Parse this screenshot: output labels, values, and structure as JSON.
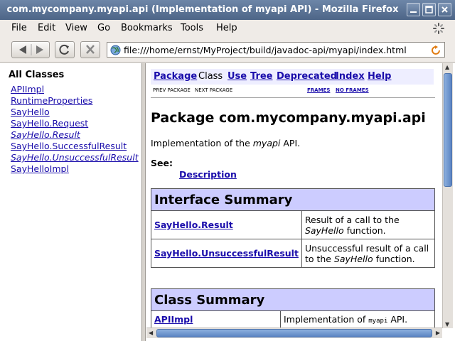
{
  "window": {
    "title": "com.mycompany.myapi.api (Implementation of myapi API) - Mozilla Firefox"
  },
  "menu": [
    "File",
    "Edit",
    "View",
    "Go",
    "Bookmarks",
    "Tools",
    "Help"
  ],
  "toolbar": {
    "back_icon": "back-arrow-icon",
    "forward_icon": "forward-arrow-icon",
    "reload_icon": "reload-icon",
    "stop_icon": "stop-icon",
    "url": "file:///home/ernst/MyProject/build/javadoc-api/myapi/index.html"
  },
  "left_frame": {
    "heading": "All Classes",
    "classes": [
      {
        "name": "APIImpl",
        "italic": false
      },
      {
        "name": "RuntimeProperties",
        "italic": false
      },
      {
        "name": "SayHello",
        "italic": false
      },
      {
        "name": "SayHello.Request",
        "italic": false
      },
      {
        "name": "SayHello.Result",
        "italic": true
      },
      {
        "name": "SayHello.SuccessfulResult",
        "italic": false
      },
      {
        "name": "SayHello.UnsuccessfulResult",
        "italic": true
      },
      {
        "name": "SayHelloImpl",
        "italic": false
      }
    ]
  },
  "doc_nav": {
    "package": "Package",
    "class": "Class",
    "use": "Use",
    "tree": "Tree",
    "deprecated": "Deprecated",
    "index": "Index",
    "help": "Help",
    "prev_package": "PREV PACKAGE",
    "next_package": "NEXT PACKAGE",
    "frames": "FRAMES",
    "no_frames": "NO FRAMES"
  },
  "page": {
    "package_title": "Package com.mycompany.myapi.api",
    "desc_prefix": "Implementation of the ",
    "desc_em": "myapi",
    "desc_suffix": " API.",
    "see_label": "See:",
    "see_link": "Description"
  },
  "interface_summary": {
    "title": "Interface Summary",
    "rows": [
      {
        "name": "SayHello.Result",
        "desc_prefix": "Result of a call to the ",
        "desc_em": "SayHello",
        "desc_suffix": " function."
      },
      {
        "name": "SayHello.UnsuccessfulResult",
        "desc_prefix": "Unsuccessful result of a call to the ",
        "desc_em": "SayHello",
        "desc_suffix": " function."
      }
    ]
  },
  "class_summary": {
    "title": "Class Summary",
    "rows": [
      {
        "name": "APIImpl",
        "desc_prefix": "Implementation of ",
        "desc_code": "myapi",
        "desc_suffix": " API."
      }
    ]
  }
}
